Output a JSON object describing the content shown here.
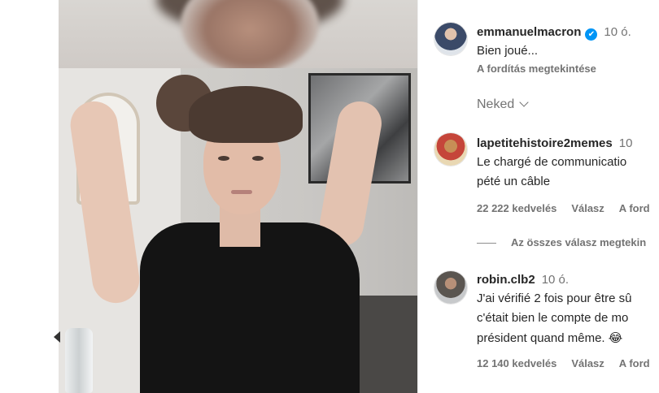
{
  "post": {
    "author": {
      "username": "emmanuelmacron",
      "verified_glyph": "✔",
      "time": "10 ó.",
      "caption": "Bien joué...",
      "translate": "A fordítás megtekintése"
    },
    "liked_by": {
      "label": "Neked",
      "icon": "chevron-down-icon"
    }
  },
  "comments": [
    {
      "username": "lapetitehistoire2memes",
      "time": "10",
      "lines": [
        "Le chargé de communicatio",
        "pété un câble"
      ],
      "likes": "22 222 kedvelés",
      "reply": "Válasz",
      "more": "A ford",
      "view_replies": "Az összes válasz megtekin"
    },
    {
      "username": "robin.clb2",
      "time": "10 ó.",
      "lines": [
        "J'ai vérifié 2 fois pour être sû",
        "c'était bien le compte de mo",
        "président quand même. 😂"
      ],
      "likes": "12 140 kedvelés",
      "reply": "Válasz",
      "more": "A ford"
    }
  ],
  "colors": {
    "verified": "#0095f6",
    "text": "#262626",
    "secondary": "#737373"
  }
}
